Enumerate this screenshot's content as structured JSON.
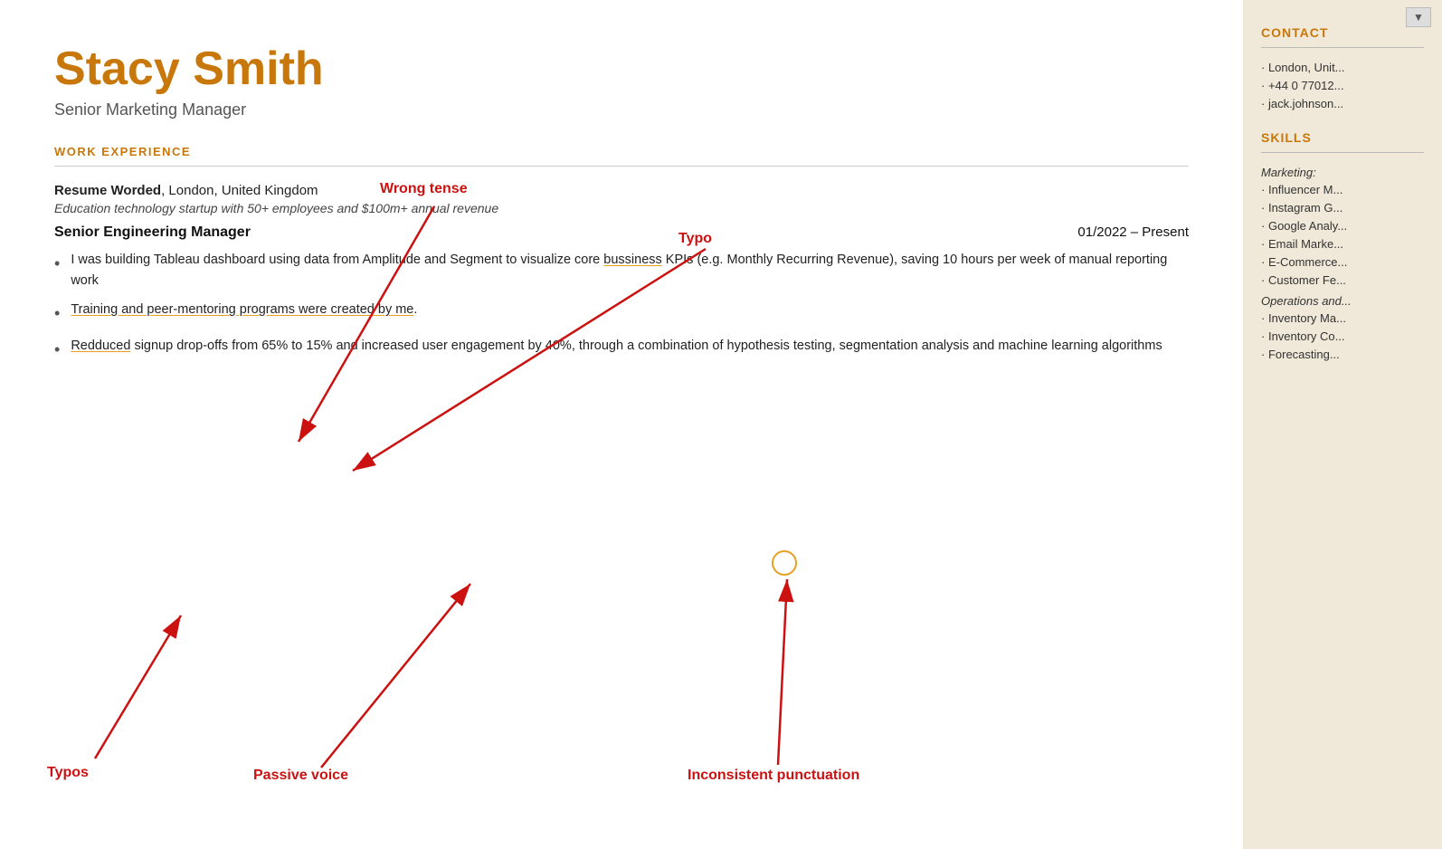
{
  "candidate": {
    "name": "Stacy Smith",
    "title": "Senior Marketing Manager"
  },
  "sections": {
    "work_experience_label": "WORK EXPERIENCE"
  },
  "job": {
    "company": "Resume Worded",
    "location": "London, United Kingdom",
    "description": "Education technology startup with 50+ employees and $100m+ annual revenue",
    "title": "Senior Engineering Manager",
    "dates": "01/2022 – Present"
  },
  "bullets": [
    {
      "text_parts": [
        {
          "text": "I was building Tableau da",
          "underline": false
        },
        {
          "text": "shboard using data from Amplitude and Segment to visualize core ",
          "underline": false
        },
        {
          "text": "bussiness",
          "underline": true
        },
        {
          "text": " KPIs (e.g. Monthly Recurring Revenue), saving 10 hours per week of manual reporting work",
          "underline": false
        }
      ]
    },
    {
      "text_parts": [
        {
          "text": "Training and peer-mentoring programs were created by me",
          "underline": true
        },
        {
          "text": ".",
          "underline": false
        }
      ]
    },
    {
      "text_parts": [
        {
          "text": "Redduced",
          "underline": true
        },
        {
          "text": " signup drop-offs from 65% to 15% and increased user engagement by 40%, through a combination of hypothesis testing, segmentation analysis and machine learning algorithms",
          "underline": false
        }
      ]
    }
  ],
  "annotations": {
    "wrong_tense": "Wrong tense",
    "typo_top": "Typo",
    "typos_bottom": "Typos",
    "passive_voice": "Passive voice",
    "inconsistent_punctuation": "Inconsistent punctuation"
  },
  "sidebar": {
    "contact_label": "CONTACT",
    "contact_items": [
      "London, Unit...",
      "+44 0 77012...",
      "jack.johnson..."
    ],
    "skills_label": "SKILLS",
    "skills_categories": [
      {
        "name": "Marketing:",
        "items": [
          "Influencer M...",
          "Instagram G...",
          "Google Analy...",
          "Email Marke...",
          "E-Commerce...",
          "Customer Fe..."
        ]
      },
      {
        "name": "Operations and...",
        "items": [
          "Inventory Ma...",
          "Inventory Co...",
          "Forecasting..."
        ]
      }
    ]
  }
}
